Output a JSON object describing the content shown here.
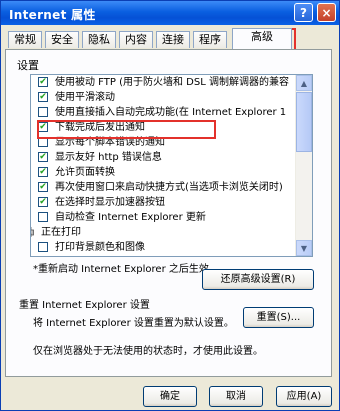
{
  "window": {
    "title": "Internet 属性"
  },
  "titlebar": {
    "help": "?",
    "close": "×"
  },
  "tabs": [
    "常规",
    "安全",
    "隐私",
    "内容",
    "连接",
    "程序",
    "高级"
  ],
  "active_tab": "高级",
  "panel": {
    "section_label": "设置",
    "items": [
      {
        "label": "使用被动 FTP (用于防火墙和 DSL 调制解调器的兼容",
        "checked": true
      },
      {
        "label": "使用平滑滚动",
        "checked": true
      },
      {
        "label": "使用直接插入自动完成功能(在 Internet Explorer 1",
        "checked": false
      },
      {
        "label": "下载完成后发出通知",
        "checked": true
      },
      {
        "label": "显示每个脚本错误的通知",
        "checked": false
      },
      {
        "label": "显示友好 http 错误信息",
        "checked": true
      },
      {
        "label": "允许页面转换",
        "checked": true
      },
      {
        "label": "再次使用窗口来启动快捷方式(当选项卡浏览关闭时)",
        "checked": true
      },
      {
        "label": "在选择时显示加速器按钮",
        "checked": true
      },
      {
        "label": "自动检查 Internet Explorer 更新",
        "checked": false
      },
      {
        "label": "正在打印",
        "checked": null
      },
      {
        "label": "打印背景颜色和图像",
        "checked": false
      }
    ],
    "restart_note": "*重新启动 Internet Explorer 之后生效",
    "restore_button": "还原高级设置(R)",
    "reset_group_label": "重置 Internet Explorer 设置",
    "reset_desc": "将 Internet Explorer 设置重置为默认设置。",
    "reset_button": "重置(S)...",
    "broken_note": "仅在浏览器处于无法使用的状态时，才使用此设置。"
  },
  "footer": {
    "ok": "确定",
    "cancel": "取消",
    "apply": "应用(A)"
  }
}
